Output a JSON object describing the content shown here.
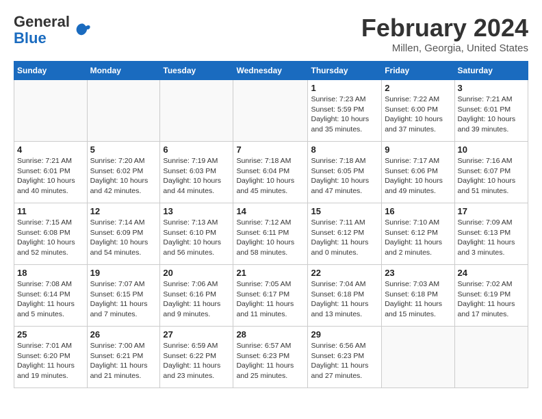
{
  "header": {
    "logo": {
      "general": "General",
      "blue": "Blue"
    },
    "title": "February 2024",
    "location": "Millen, Georgia, United States"
  },
  "weekdays": [
    "Sunday",
    "Monday",
    "Tuesday",
    "Wednesday",
    "Thursday",
    "Friday",
    "Saturday"
  ],
  "weeks": [
    [
      {
        "day": "",
        "info": ""
      },
      {
        "day": "",
        "info": ""
      },
      {
        "day": "",
        "info": ""
      },
      {
        "day": "",
        "info": ""
      },
      {
        "day": "1",
        "info": "Sunrise: 7:23 AM\nSunset: 5:59 PM\nDaylight: 10 hours\nand 35 minutes."
      },
      {
        "day": "2",
        "info": "Sunrise: 7:22 AM\nSunset: 6:00 PM\nDaylight: 10 hours\nand 37 minutes."
      },
      {
        "day": "3",
        "info": "Sunrise: 7:21 AM\nSunset: 6:01 PM\nDaylight: 10 hours\nand 39 minutes."
      }
    ],
    [
      {
        "day": "4",
        "info": "Sunrise: 7:21 AM\nSunset: 6:01 PM\nDaylight: 10 hours\nand 40 minutes."
      },
      {
        "day": "5",
        "info": "Sunrise: 7:20 AM\nSunset: 6:02 PM\nDaylight: 10 hours\nand 42 minutes."
      },
      {
        "day": "6",
        "info": "Sunrise: 7:19 AM\nSunset: 6:03 PM\nDaylight: 10 hours\nand 44 minutes."
      },
      {
        "day": "7",
        "info": "Sunrise: 7:18 AM\nSunset: 6:04 PM\nDaylight: 10 hours\nand 45 minutes."
      },
      {
        "day": "8",
        "info": "Sunrise: 7:18 AM\nSunset: 6:05 PM\nDaylight: 10 hours\nand 47 minutes."
      },
      {
        "day": "9",
        "info": "Sunrise: 7:17 AM\nSunset: 6:06 PM\nDaylight: 10 hours\nand 49 minutes."
      },
      {
        "day": "10",
        "info": "Sunrise: 7:16 AM\nSunset: 6:07 PM\nDaylight: 10 hours\nand 51 minutes."
      }
    ],
    [
      {
        "day": "11",
        "info": "Sunrise: 7:15 AM\nSunset: 6:08 PM\nDaylight: 10 hours\nand 52 minutes."
      },
      {
        "day": "12",
        "info": "Sunrise: 7:14 AM\nSunset: 6:09 PM\nDaylight: 10 hours\nand 54 minutes."
      },
      {
        "day": "13",
        "info": "Sunrise: 7:13 AM\nSunset: 6:10 PM\nDaylight: 10 hours\nand 56 minutes."
      },
      {
        "day": "14",
        "info": "Sunrise: 7:12 AM\nSunset: 6:11 PM\nDaylight: 10 hours\nand 58 minutes."
      },
      {
        "day": "15",
        "info": "Sunrise: 7:11 AM\nSunset: 6:12 PM\nDaylight: 11 hours\nand 0 minutes."
      },
      {
        "day": "16",
        "info": "Sunrise: 7:10 AM\nSunset: 6:12 PM\nDaylight: 11 hours\nand 2 minutes."
      },
      {
        "day": "17",
        "info": "Sunrise: 7:09 AM\nSunset: 6:13 PM\nDaylight: 11 hours\nand 3 minutes."
      }
    ],
    [
      {
        "day": "18",
        "info": "Sunrise: 7:08 AM\nSunset: 6:14 PM\nDaylight: 11 hours\nand 5 minutes."
      },
      {
        "day": "19",
        "info": "Sunrise: 7:07 AM\nSunset: 6:15 PM\nDaylight: 11 hours\nand 7 minutes."
      },
      {
        "day": "20",
        "info": "Sunrise: 7:06 AM\nSunset: 6:16 PM\nDaylight: 11 hours\nand 9 minutes."
      },
      {
        "day": "21",
        "info": "Sunrise: 7:05 AM\nSunset: 6:17 PM\nDaylight: 11 hours\nand 11 minutes."
      },
      {
        "day": "22",
        "info": "Sunrise: 7:04 AM\nSunset: 6:18 PM\nDaylight: 11 hours\nand 13 minutes."
      },
      {
        "day": "23",
        "info": "Sunrise: 7:03 AM\nSunset: 6:18 PM\nDaylight: 11 hours\nand 15 minutes."
      },
      {
        "day": "24",
        "info": "Sunrise: 7:02 AM\nSunset: 6:19 PM\nDaylight: 11 hours\nand 17 minutes."
      }
    ],
    [
      {
        "day": "25",
        "info": "Sunrise: 7:01 AM\nSunset: 6:20 PM\nDaylight: 11 hours\nand 19 minutes."
      },
      {
        "day": "26",
        "info": "Sunrise: 7:00 AM\nSunset: 6:21 PM\nDaylight: 11 hours\nand 21 minutes."
      },
      {
        "day": "27",
        "info": "Sunrise: 6:59 AM\nSunset: 6:22 PM\nDaylight: 11 hours\nand 23 minutes."
      },
      {
        "day": "28",
        "info": "Sunrise: 6:57 AM\nSunset: 6:23 PM\nDaylight: 11 hours\nand 25 minutes."
      },
      {
        "day": "29",
        "info": "Sunrise: 6:56 AM\nSunset: 6:23 PM\nDaylight: 11 hours\nand 27 minutes."
      },
      {
        "day": "",
        "info": ""
      },
      {
        "day": "",
        "info": ""
      }
    ]
  ]
}
